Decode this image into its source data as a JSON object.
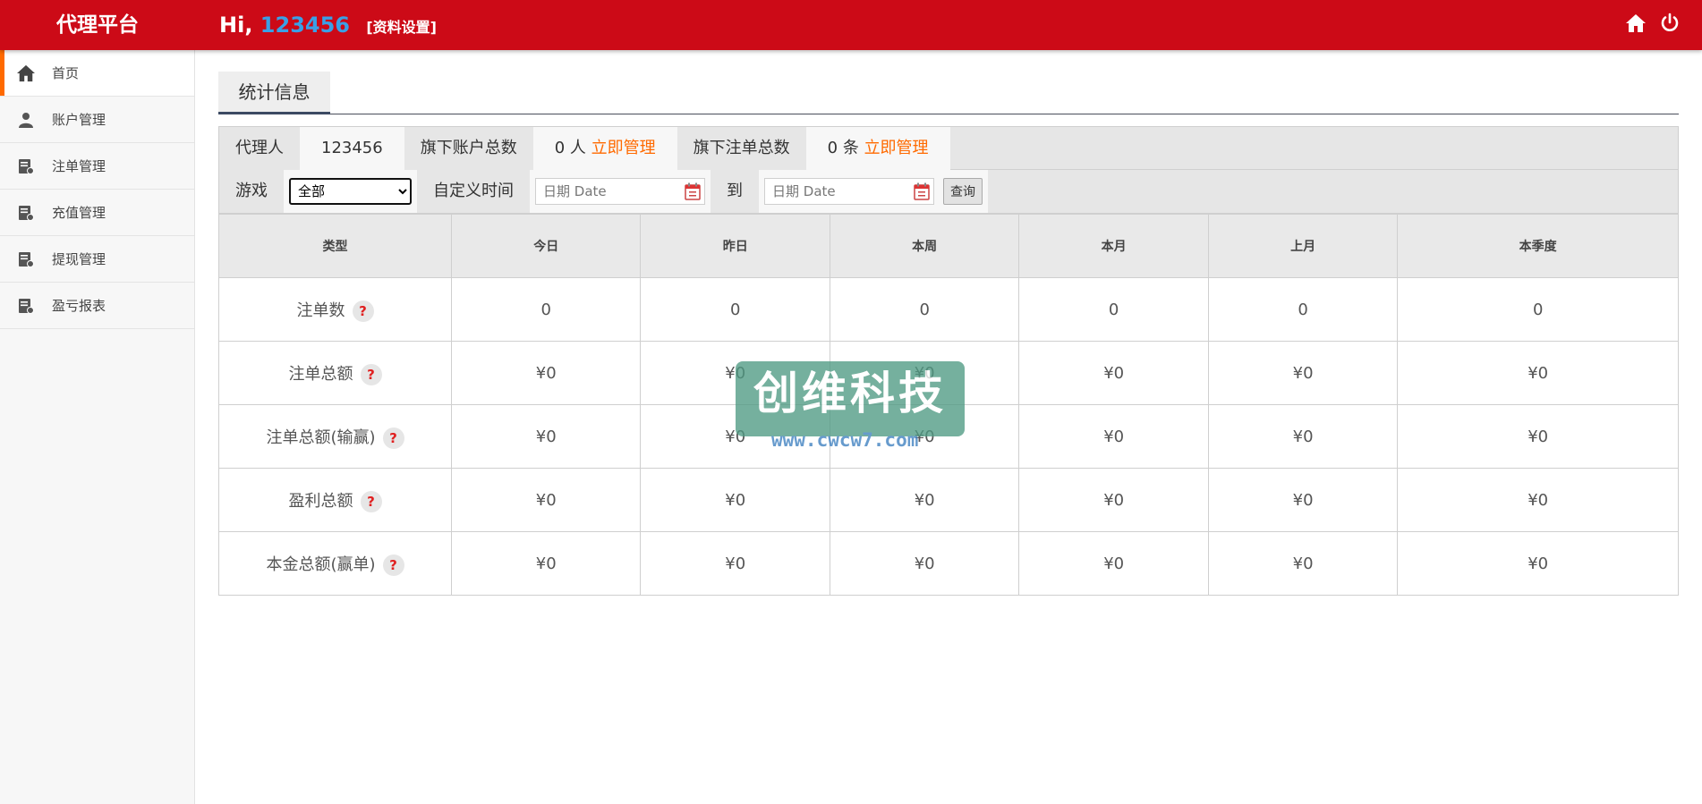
{
  "topbar": {
    "brand": "代理平台",
    "greeting_prefix": "Hi, ",
    "user_id": "123456",
    "settings_label": "[资料设置]",
    "home_icon": "home-icon",
    "power_icon": "power-icon"
  },
  "sidebar": {
    "items": [
      {
        "label": "首页",
        "icon": "home-icon"
      },
      {
        "label": "账户管理",
        "icon": "user-icon"
      },
      {
        "label": "注单管理",
        "icon": "list-icon"
      },
      {
        "label": "充值管理",
        "icon": "list-icon"
      },
      {
        "label": "提现管理",
        "icon": "list-icon"
      },
      {
        "label": "盈亏报表",
        "icon": "list-icon"
      }
    ]
  },
  "main": {
    "tab_label": "统计信息",
    "agent": {
      "label": "代理人",
      "value": "123456"
    },
    "accounts": {
      "label": "旗下账户总数",
      "value": "0 人",
      "link": "立即管理"
    },
    "orders": {
      "label": "旗下注单总数",
      "value": "0 条",
      "link": "立即管理"
    },
    "filter": {
      "game_label": "游戏",
      "game_selected": "全部",
      "time_label": "自定义时间",
      "date_from_placeholder": "日期 Date",
      "to_label": "到",
      "date_to_placeholder": "日期 Date",
      "query_label": "查询"
    },
    "table": {
      "headers": [
        "类型",
        "今日",
        "昨日",
        "本周",
        "本月",
        "上月",
        "本季度"
      ],
      "rows": [
        {
          "label": "注单数",
          "values": [
            "0",
            "0",
            "0",
            "0",
            "0",
            "0"
          ]
        },
        {
          "label": "注单总额",
          "values": [
            "¥0",
            "¥0",
            "¥0",
            "¥0",
            "¥0",
            "¥0"
          ]
        },
        {
          "label": "注单总额(输赢)",
          "values": [
            "¥0",
            "¥0",
            "¥0",
            "¥0",
            "¥0",
            "¥0"
          ]
        },
        {
          "label": "盈利总额",
          "values": [
            "¥0",
            "¥0",
            "¥0",
            "¥0",
            "¥0",
            "¥0"
          ]
        },
        {
          "label": "本金总额(赢单)",
          "values": [
            "¥0",
            "¥0",
            "¥0",
            "¥0",
            "¥0",
            "¥0"
          ]
        }
      ],
      "help_glyph": "?"
    }
  },
  "watermark": {
    "title": "创维科技",
    "url": "www.cwcw7.com"
  },
  "colors": {
    "topbar": "#cc0a17",
    "accent": "#ff6a00",
    "user_id": "#3aa0e6"
  }
}
